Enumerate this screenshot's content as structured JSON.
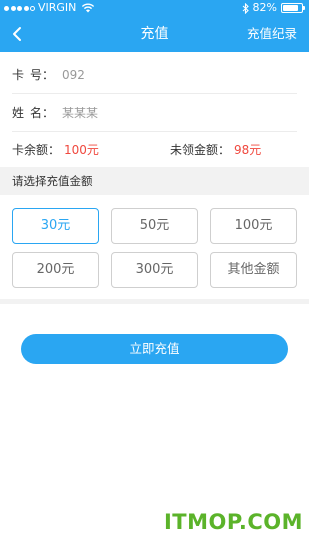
{
  "status_bar": {
    "carrier": "VIRGIN",
    "battery": "82%",
    "battery_level": 0.82,
    "icons": [
      "signal-dots",
      "wifi-icon",
      "bluetooth-icon",
      "battery-icon"
    ]
  },
  "nav": {
    "back_icon": "chevron-left-icon",
    "title": "充值",
    "action": "充值纪录"
  },
  "info": {
    "card_label": "卡　号：",
    "card_label_parts": [
      "卡",
      "号："
    ],
    "card_value": "092",
    "name_label_parts": [
      "姓",
      "名："
    ],
    "name_value": "某某某",
    "balance_label": "卡余额：",
    "balance_value": "100元",
    "unclaimed_label": "未领金额：",
    "unclaimed_value": "98元"
  },
  "section": {
    "title": "请选择充值金额"
  },
  "amounts": {
    "options": [
      "30元",
      "50元",
      "100元",
      "200元",
      "300元",
      "其他金额"
    ],
    "selected": "30元"
  },
  "submit_label": "立即充值",
  "watermark": "ITMOP.COM",
  "colors": {
    "primary": "#2aa6f2",
    "red": "#f0483e",
    "watermark": "#5bb32a"
  }
}
